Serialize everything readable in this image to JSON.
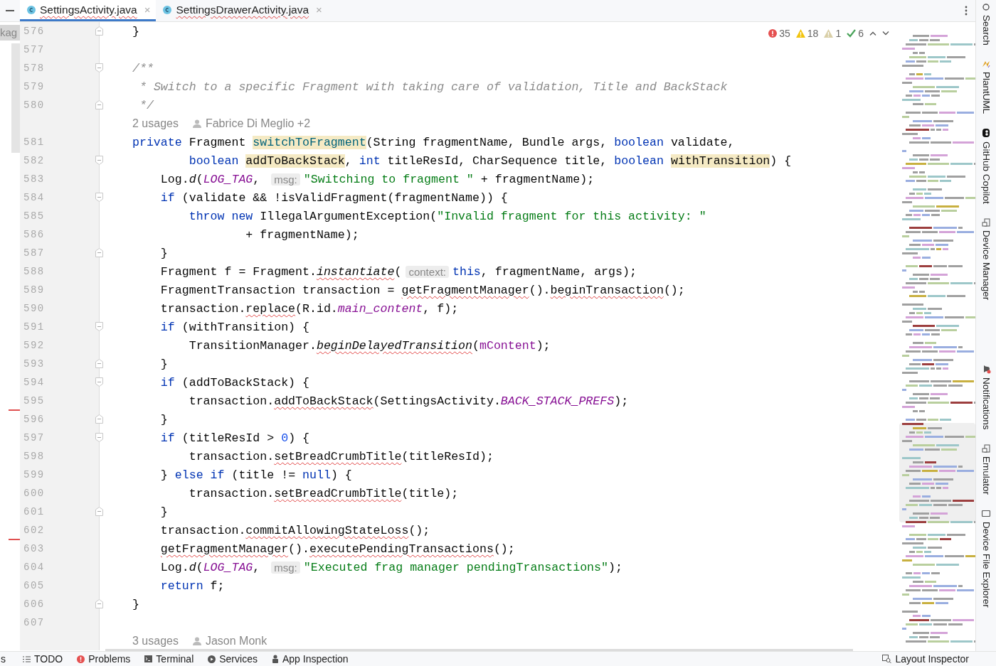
{
  "tabs": [
    {
      "label": "SettingsActivity.java",
      "selected": true,
      "close": "×"
    },
    {
      "label": "SettingsDrawerActivity.java",
      "selected": false,
      "close": "×"
    }
  ],
  "left_panel": {
    "label": "kag"
  },
  "inspections": [
    {
      "kind": "error",
      "count": "35"
    },
    {
      "kind": "warning",
      "count": "18"
    },
    {
      "kind": "weak",
      "count": "1"
    },
    {
      "kind": "ok",
      "count": "6"
    }
  ],
  "lines": [
    {
      "kind": "fold-end",
      "number": "576",
      "deleted_above": false,
      "tokens": [
        {
          "kind": "plain",
          "text": "}"
        }
      ]
    },
    {
      "kind": "code",
      "number": "577",
      "deleted_above": false
    },
    {
      "kind": "fold-start",
      "number": "578",
      "deleted_above": false,
      "tokens": [
        {
          "kind": "comment",
          "text": "/**"
        }
      ]
    },
    {
      "kind": "code",
      "number": "579",
      "deleted_above": false,
      "tokens": [
        {
          "kind": "comment",
          "text": " * Switch to a specific Fragment with taking care of validation, Title and BackStack"
        }
      ]
    },
    {
      "kind": "fold-end",
      "number": "580",
      "deleted_above": false,
      "tokens": [
        {
          "kind": "comment",
          "text": " */"
        }
      ]
    },
    {
      "kind": "lens",
      "usages": "2 usages",
      "author": "Fabrice Di Meglio +2",
      "deleted_above": false
    },
    {
      "kind": "code",
      "number": "581",
      "deleted_above": false,
      "tokens": [
        {
          "kind": "kw",
          "text": "private"
        },
        {
          "kind": "plain",
          "text": " Fragment "
        },
        {
          "kind": "decl",
          "text": "switchToFragment"
        },
        {
          "kind": "plain",
          "text": "(String fragmentName, Bundle args, "
        },
        {
          "kind": "kw",
          "text": "boolean"
        },
        {
          "kind": "plain",
          "text": " validate,"
        }
      ]
    },
    {
      "kind": "fold-start",
      "number": "582",
      "deleted_above": false,
      "tokens": [
        {
          "kind": "kw",
          "text": "        boolean "
        },
        {
          "kind": "usage",
          "text": "addToBackStack"
        },
        {
          "kind": "plain",
          "text": ", "
        },
        {
          "kind": "kw",
          "text": "int"
        },
        {
          "kind": "plain",
          "text": " titleResId, CharSequence title, "
        },
        {
          "kind": "kw",
          "text": "boolean "
        },
        {
          "kind": "usage",
          "text": "withTransition"
        },
        {
          "kind": "plain",
          "text": ") {"
        }
      ]
    },
    {
      "kind": "code",
      "number": "583",
      "deleted_above": false,
      "tokens": [
        {
          "kind": "plain",
          "text": "    Log."
        },
        {
          "kind": "italic",
          "text": "d"
        },
        {
          "kind": "plain",
          "text": "("
        },
        {
          "kind": "const",
          "text": "LOG_TAG"
        },
        {
          "kind": "plain",
          "text": ", "
        },
        {
          "kind": "hint",
          "text": "msg:"
        },
        {
          "kind": "str",
          "text": "\"Switching to fragment \""
        },
        {
          "kind": "plain",
          "text": " + fragmentName);"
        }
      ]
    },
    {
      "kind": "fold-start",
      "number": "584",
      "deleted_above": false,
      "tokens": [
        {
          "kind": "kw",
          "text": "    if"
        },
        {
          "kind": "plain",
          "text": " (validate && !isValidFragment(fragmentName)) {"
        }
      ]
    },
    {
      "kind": "code",
      "number": "585",
      "deleted_above": false,
      "tokens": [
        {
          "kind": "kw",
          "text": "        throw new"
        },
        {
          "kind": "plain",
          "text": " IllegalArgumentException("
        },
        {
          "kind": "str",
          "text": "\"Invalid fragment for this activity: \""
        }
      ]
    },
    {
      "kind": "code",
      "number": "586",
      "deleted_above": false,
      "tokens": [
        {
          "kind": "plain",
          "text": "                + fragmentName);"
        }
      ]
    },
    {
      "kind": "fold-end",
      "number": "587",
      "deleted_above": false,
      "tokens": [
        {
          "kind": "plain",
          "text": "    }"
        }
      ]
    },
    {
      "kind": "code",
      "number": "588",
      "deleted_above": false,
      "tokens": [
        {
          "kind": "plain",
          "text": "    Fragment f = Fragment."
        },
        {
          "kind": "italic-warn",
          "text": "instantiate"
        },
        {
          "kind": "plain",
          "text": "("
        },
        {
          "kind": "hint",
          "text": "context:"
        },
        {
          "kind": "kw",
          "text": "this"
        },
        {
          "kind": "plain",
          "text": ", fragmentName, args);"
        }
      ]
    },
    {
      "kind": "code",
      "number": "589",
      "deleted_above": false,
      "tokens": [
        {
          "kind": "plain",
          "text": "    FragmentTransaction transaction = "
        },
        {
          "kind": "warn",
          "text": "getFragmentManager"
        },
        {
          "kind": "plain",
          "text": "()."
        },
        {
          "kind": "warn",
          "text": "beginTransaction"
        },
        {
          "kind": "plain",
          "text": "();"
        }
      ]
    },
    {
      "kind": "code",
      "number": "590",
      "deleted_above": false,
      "tokens": [
        {
          "kind": "plain",
          "text": "    transaction."
        },
        {
          "kind": "warn",
          "text": "replace"
        },
        {
          "kind": "plain",
          "text": "(R.id."
        },
        {
          "kind": "const",
          "text": "main_content"
        },
        {
          "kind": "plain",
          "text": ", f);"
        }
      ]
    },
    {
      "kind": "fold-start",
      "number": "591",
      "deleted_above": false,
      "tokens": [
        {
          "kind": "kw",
          "text": "    if"
        },
        {
          "kind": "plain",
          "text": " (withTransition) {"
        }
      ]
    },
    {
      "kind": "code",
      "number": "592",
      "deleted_above": false,
      "tokens": [
        {
          "kind": "plain",
          "text": "        TransitionManager."
        },
        {
          "kind": "italic-warn",
          "text": "beginDelayedTransition"
        },
        {
          "kind": "plain",
          "text": "("
        },
        {
          "kind": "field",
          "text": "mContent"
        },
        {
          "kind": "plain",
          "text": ");"
        }
      ]
    },
    {
      "kind": "fold-end",
      "number": "593",
      "deleted_above": false,
      "tokens": [
        {
          "kind": "plain",
          "text": "    }"
        }
      ]
    },
    {
      "kind": "fold-start",
      "number": "594",
      "deleted_above": false,
      "tokens": [
        {
          "kind": "kw",
          "text": "    if"
        },
        {
          "kind": "plain",
          "text": " (addToBackStack) {"
        }
      ]
    },
    {
      "kind": "code",
      "number": "595",
      "deleted_above": false,
      "tokens": [
        {
          "kind": "plain",
          "text": "        transaction."
        },
        {
          "kind": "warn",
          "text": "addToBackStack"
        },
        {
          "kind": "plain",
          "text": "(SettingsActivity."
        },
        {
          "kind": "const",
          "text": "BACK_STACK_PREFS"
        },
        {
          "kind": "plain",
          "text": ");"
        }
      ]
    },
    {
      "kind": "fold-end",
      "number": "596",
      "deleted_above": true,
      "tokens": [
        {
          "kind": "plain",
          "text": "    }"
        }
      ]
    },
    {
      "kind": "fold-start",
      "number": "597",
      "deleted_above": false,
      "tokens": [
        {
          "kind": "kw",
          "text": "    if"
        },
        {
          "kind": "plain",
          "text": " (titleResId > "
        },
        {
          "kind": "num",
          "text": "0"
        },
        {
          "kind": "plain",
          "text": ") {"
        }
      ]
    },
    {
      "kind": "code",
      "number": "598",
      "deleted_above": false,
      "tokens": [
        {
          "kind": "plain",
          "text": "        transaction."
        },
        {
          "kind": "warn",
          "text": "setBreadCrumbTitle"
        },
        {
          "kind": "plain",
          "text": "(titleResId);"
        }
      ]
    },
    {
      "kind": "code",
      "number": "599",
      "deleted_above": false,
      "tokens": [
        {
          "kind": "plain",
          "text": "    } "
        },
        {
          "kind": "kw",
          "text": "else if"
        },
        {
          "kind": "plain",
          "text": " (title != "
        },
        {
          "kind": "kw",
          "text": "null"
        },
        {
          "kind": "plain",
          "text": ") {"
        }
      ]
    },
    {
      "kind": "code",
      "number": "600",
      "deleted_above": false,
      "tokens": [
        {
          "kind": "plain",
          "text": "        transaction."
        },
        {
          "kind": "warn",
          "text": "setBreadCrumbTitle"
        },
        {
          "kind": "plain",
          "text": "(title);"
        }
      ]
    },
    {
      "kind": "fold-end",
      "number": "601",
      "deleted_above": false,
      "tokens": [
        {
          "kind": "plain",
          "text": "    }"
        }
      ]
    },
    {
      "kind": "code",
      "number": "602",
      "deleted_above": false,
      "tokens": [
        {
          "kind": "plain",
          "text": "    transaction."
        },
        {
          "kind": "warn",
          "text": "commitAllowingStateLoss"
        },
        {
          "kind": "plain",
          "text": "();"
        }
      ]
    },
    {
      "kind": "code",
      "number": "603",
      "deleted_above": true,
      "tokens": [
        {
          "kind": "warn",
          "text": "    getFragmentManager"
        },
        {
          "kind": "plain",
          "text": "()."
        },
        {
          "kind": "warn",
          "text": "executePendingTransactions"
        },
        {
          "kind": "plain",
          "text": "();"
        }
      ]
    },
    {
      "kind": "code",
      "number": "604",
      "deleted_above": false,
      "tokens": [
        {
          "kind": "plain",
          "text": "    Log."
        },
        {
          "kind": "italic",
          "text": "d"
        },
        {
          "kind": "plain",
          "text": "("
        },
        {
          "kind": "const",
          "text": "LOG_TAG"
        },
        {
          "kind": "plain",
          "text": ", "
        },
        {
          "kind": "hint",
          "text": "msg:"
        },
        {
          "kind": "str",
          "text": "\"Executed frag manager pendingTransactions\""
        },
        {
          "kind": "plain",
          "text": ");"
        }
      ]
    },
    {
      "kind": "code",
      "number": "605",
      "deleted_above": false,
      "tokens": [
        {
          "kind": "kw",
          "text": "    return"
        },
        {
          "kind": "plain",
          "text": " f;"
        }
      ]
    },
    {
      "kind": "fold-end",
      "number": "606",
      "deleted_above": false,
      "tokens": [
        {
          "kind": "plain",
          "text": "}"
        }
      ]
    },
    {
      "kind": "code",
      "number": "607",
      "deleted_above": false
    },
    {
      "kind": "lens",
      "usages": "3 usages",
      "author": "Jason Monk",
      "deleted_above": false
    }
  ],
  "right_tools": [
    {
      "kind": "search",
      "label": "Search"
    },
    {
      "kind": "plantuml",
      "label": "PlantUML"
    },
    {
      "kind": "copilot",
      "label": "GitHub Copilot"
    },
    {
      "kind": "device",
      "label": "Device Manager"
    },
    {
      "kind": "bell",
      "label": "Notifications"
    },
    {
      "kind": "emulator",
      "label": "Emulator"
    },
    {
      "kind": "phone",
      "label": "Device File Explorer"
    }
  ],
  "bottom_tools": [
    {
      "kind": "cut",
      "label": "s"
    },
    {
      "kind": "list",
      "label": "TODO"
    },
    {
      "kind": "error",
      "label": "Problems"
    },
    {
      "kind": "terminal",
      "label": "Terminal"
    },
    {
      "kind": "play",
      "label": "Services"
    },
    {
      "kind": "inspect",
      "label": "App Inspection"
    }
  ],
  "bottom_right_tool": {
    "kind": "layout",
    "label": "Layout Inspector"
  }
}
